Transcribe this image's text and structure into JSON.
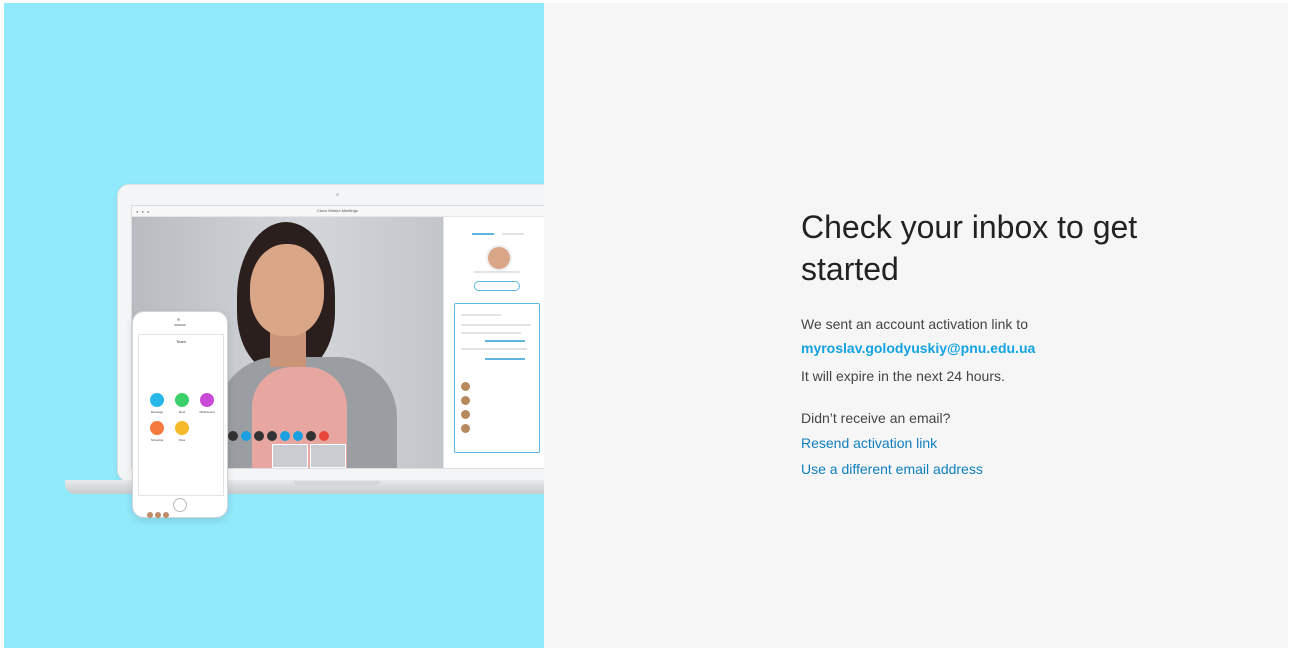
{
  "illustration": {
    "window_title": "Cisco Webex Meetings",
    "phone_title": "Team",
    "phone_apps": [
      {
        "label": "Message",
        "color": "#29b6e8"
      },
      {
        "label": "Meet",
        "color": "#3ccf6a"
      },
      {
        "label": "Whiteboard",
        "color": "#c94ad6"
      },
      {
        "label": "Schedule",
        "color": "#f47a3e"
      },
      {
        "label": "Files",
        "color": "#f6b929"
      }
    ]
  },
  "confirmation": {
    "heading": "Check your inbox to get started",
    "sent_text": "We sent an account activation link to",
    "email": "myroslav.golodyuskiy@pnu.edu.ua",
    "expire_text": "It will expire in the next 24 hours.",
    "not_received_text": "Didn’t receive an email?",
    "resend_link": "Resend activation link",
    "different_email_link": "Use a different email address"
  },
  "colors": {
    "left_background": "#91eafb",
    "right_background": "#f6f6f6",
    "link": "#0f7fbf",
    "email": "#13a2e2"
  }
}
